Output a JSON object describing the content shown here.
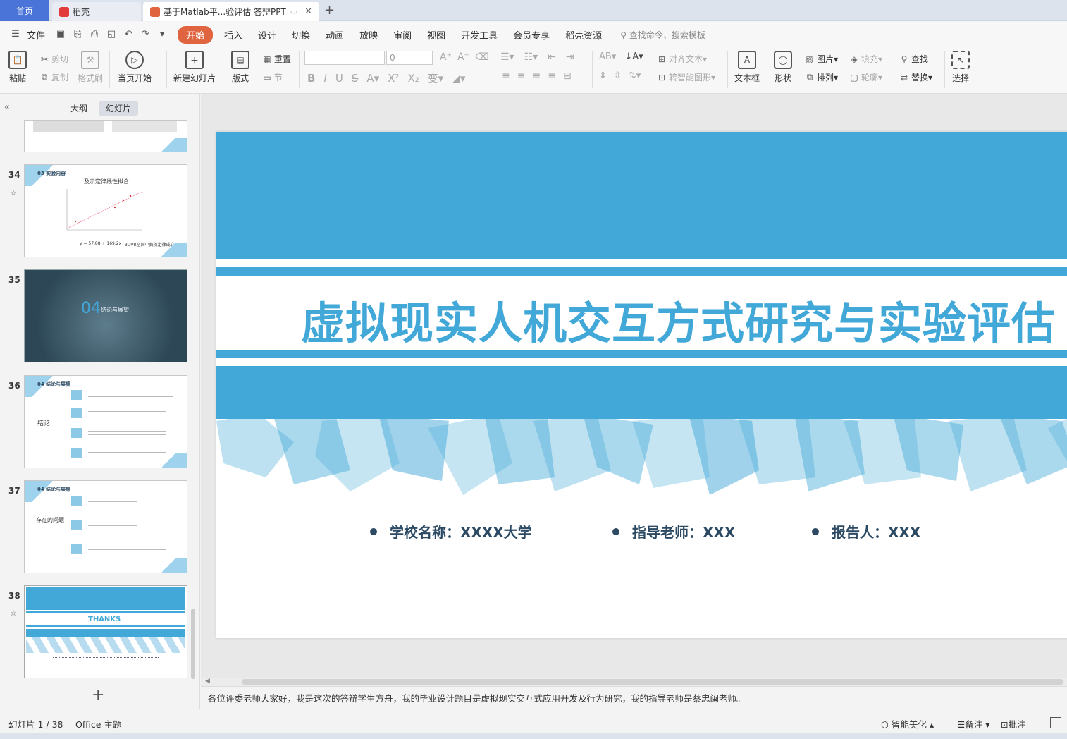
{
  "tabs": {
    "home": "首页",
    "daoke": "稻壳",
    "doc": "基于Matlab平...验评估 答辩PPT",
    "new_tab": "+",
    "close": "✕"
  },
  "menu": {
    "file": "文件",
    "items": [
      "开始",
      "插入",
      "设计",
      "切换",
      "动画",
      "放映",
      "审阅",
      "视图",
      "开发工具",
      "会员专享",
      "稻壳资源"
    ],
    "search_placeholder": "查找命令、搜索模板"
  },
  "ribbon": {
    "paste": "粘贴",
    "cut": "剪切",
    "copy": "复制",
    "format_painter": "格式刷",
    "from_start": "当页开始",
    "new_slide": "新建幻灯片",
    "layout": "版式",
    "reset": "重置",
    "section": "节",
    "font_size": "0",
    "align_text": "对齐文本",
    "to_smartart": "转智能图形",
    "textbox": "文本框",
    "shape": "形状",
    "picture": "图片",
    "arrange": "排列",
    "fill": "填充",
    "outline": "轮廓",
    "find": "查找",
    "replace": "替换",
    "select": "选择"
  },
  "left_panel": {
    "tab_outline": "大纲",
    "tab_slides": "幻灯片",
    "slides": [
      {
        "num": "34",
        "section": "03 实验内容",
        "chart_title": "及示定律线性拟合",
        "eq": "y = 57.88 + 169.2x",
        "note": "3DVR空间中费茨定律成立"
      },
      {
        "num": "35",
        "big": "04",
        "text": "结论与展望"
      },
      {
        "num": "36",
        "section": "04 结论与展望",
        "label": "结论"
      },
      {
        "num": "37",
        "section": "04 结论与展望",
        "label": "存在的问题"
      },
      {
        "num": "38",
        "thanks": "THANKS"
      }
    ],
    "add": "+"
  },
  "slide": {
    "title": "虚拟现实人机交互方式研究与实验评估",
    "school": "学校名称：XXXX大学",
    "advisor": "指导老师：XXX",
    "reporter": "报告人：XXX"
  },
  "notes": "各位评委老师大家好，我是这次的答辩学生方舟，我的毕业设计题目是虚拟现实交互式应用开发及行为研究，我的指导老师是蔡忠闽老师。",
  "status": {
    "slide_count": "幻灯片 1 / 38",
    "theme": "Office 主题",
    "beautify": "智能美化",
    "notes_btn": "备注",
    "comment_btn": "批注"
  }
}
